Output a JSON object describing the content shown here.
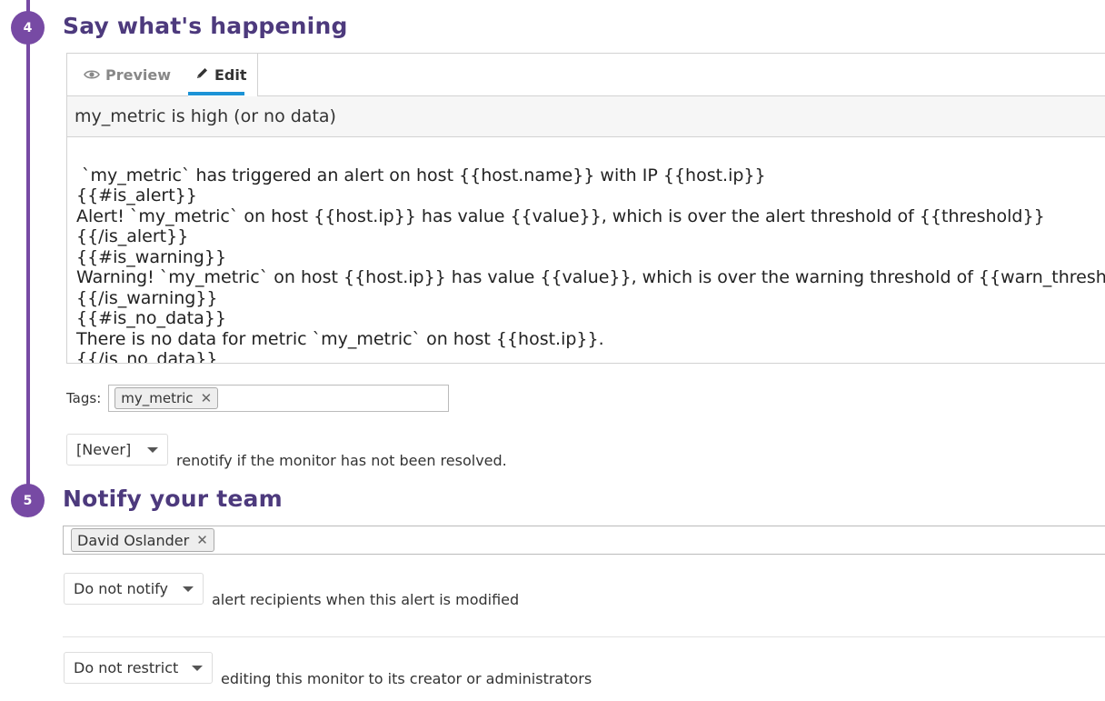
{
  "step4": {
    "number": "4",
    "title": "Say what's happening",
    "tabs": {
      "preview": "Preview",
      "edit": "Edit"
    },
    "subject": "my_metric is high (or no data)",
    "body_lines": [
      " `my_metric` has triggered an alert on host {{host.name}} with IP {{host.ip}}",
      "{{#is_alert}}",
      "Alert! `my_metric` on host {{host.ip}} has value {{value}}, which is over the alert threshold of {{threshold}}",
      "{{/is_alert}}",
      "{{#is_warning}}",
      "Warning! `my_metric` on host {{host.ip}} has value {{value}}, which is over the warning threshold of {{warn_threshold}}",
      "{{/is_warning}}",
      "{{#is_no_data}}",
      "There is no data for metric `my_metric` on host {{host.ip}}.",
      "{{/is_no_data}}"
    ],
    "tags_label": "Tags:",
    "tags": [
      "my_metric"
    ],
    "renotify_value": "[Never]",
    "renotify_text": "renotify if the monitor has not been resolved."
  },
  "step5": {
    "number": "5",
    "title": "Notify your team",
    "recipients": [
      "David Oslander"
    ],
    "notify_value": "Do not notify",
    "notify_text": "alert recipients when this alert is modified",
    "restrict_value": "Do not restrict",
    "restrict_text": "editing this monitor to its creator or administrators"
  },
  "colors": {
    "accent": "#774aa4",
    "title": "#4d3a7d",
    "tab_underline": "#1c93d6"
  },
  "icons": {
    "preview": "eye-icon",
    "edit": "pencil-icon",
    "remove": "close-icon",
    "dropdown": "caret-down-icon"
  }
}
